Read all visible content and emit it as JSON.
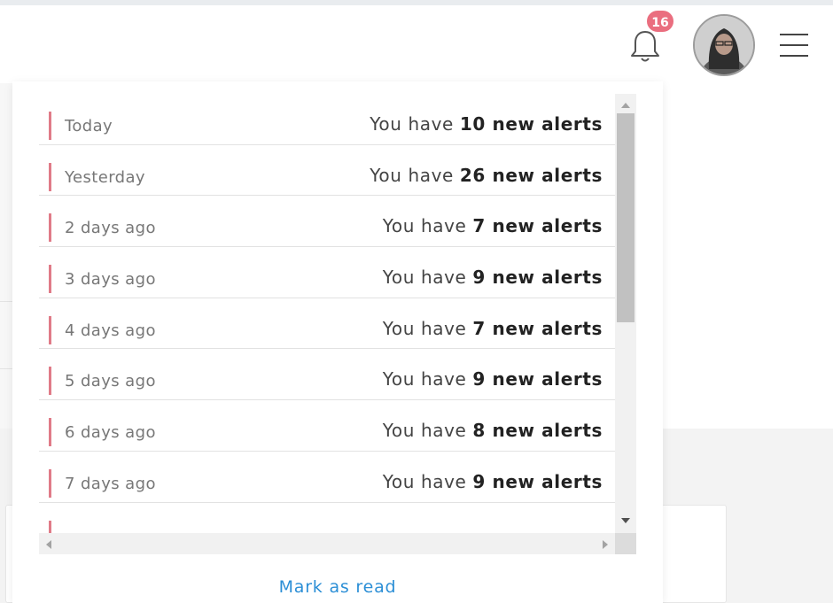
{
  "header": {
    "notification_count": "16",
    "icons": {
      "bell": "bell-icon",
      "avatar": "user-avatar",
      "menu": "hamburger-menu-icon"
    },
    "badge_color": "#ea6e7f"
  },
  "notifications": {
    "accent_color": "#e07b88",
    "items": [
      {
        "when": "Today",
        "prefix": "You have ",
        "emphasis": "10 new alerts"
      },
      {
        "when": "Yesterday",
        "prefix": "You have ",
        "emphasis": "26 new alerts"
      },
      {
        "when": "2 days ago",
        "prefix": "You have ",
        "emphasis": "7 new alerts"
      },
      {
        "when": "3 days ago",
        "prefix": "You have ",
        "emphasis": "9 new alerts"
      },
      {
        "when": "4 days ago",
        "prefix": "You have ",
        "emphasis": "7 new alerts"
      },
      {
        "when": "5 days ago",
        "prefix": "You have ",
        "emphasis": "9 new alerts"
      },
      {
        "when": "6 days ago",
        "prefix": "You have ",
        "emphasis": "8 new alerts"
      },
      {
        "when": "7 days ago",
        "prefix": "You have ",
        "emphasis": "9 new alerts"
      }
    ],
    "mark_as_read_label": "Mark as read",
    "link_color": "#2c8fd6"
  }
}
